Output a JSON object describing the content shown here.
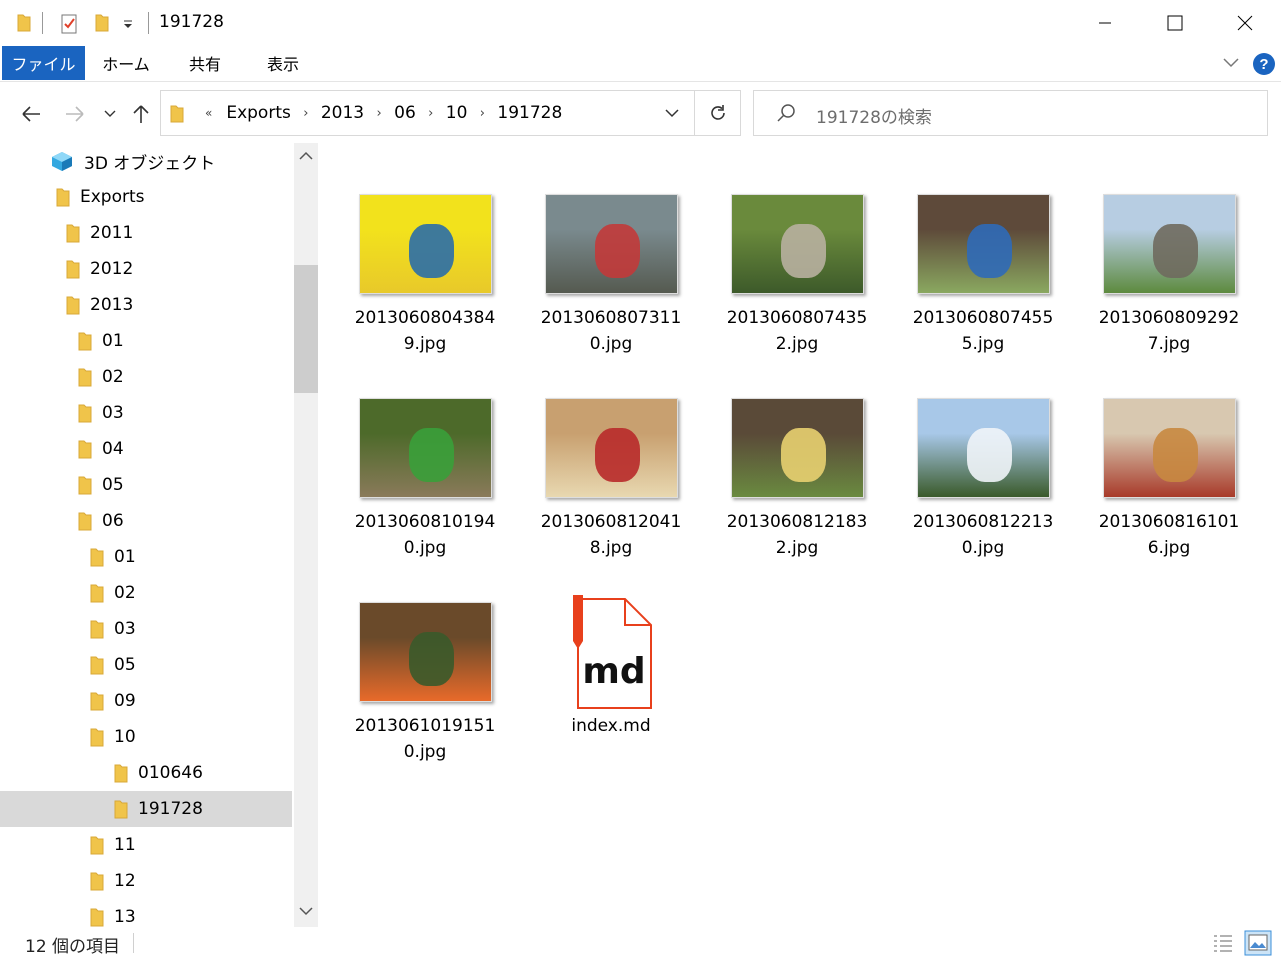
{
  "window": {
    "title": "191728"
  },
  "ribbon": {
    "tabs": [
      "ファイル",
      "ホーム",
      "共有",
      "表示"
    ]
  },
  "address": {
    "crumbs": [
      "Exports",
      "2013",
      "06",
      "10",
      "191728"
    ],
    "overflow": "«"
  },
  "search": {
    "placeholder": "191728の検索"
  },
  "tree": [
    {
      "label": "3D オブジェクト",
      "level": 0,
      "icon": "3d-objects-icon"
    },
    {
      "label": "Exports",
      "level": 0,
      "icon": "folder-icon"
    },
    {
      "label": "2011",
      "level": 1,
      "icon": "folder-icon"
    },
    {
      "label": "2012",
      "level": 1,
      "icon": "folder-icon"
    },
    {
      "label": "2013",
      "level": 1,
      "icon": "folder-icon"
    },
    {
      "label": "01",
      "level": 2,
      "icon": "folder-icon"
    },
    {
      "label": "02",
      "level": 2,
      "icon": "folder-icon"
    },
    {
      "label": "03",
      "level": 2,
      "icon": "folder-icon"
    },
    {
      "label": "04",
      "level": 2,
      "icon": "folder-icon"
    },
    {
      "label": "05",
      "level": 2,
      "icon": "folder-icon"
    },
    {
      "label": "06",
      "level": 2,
      "icon": "folder-icon"
    },
    {
      "label": "01",
      "level": 3,
      "icon": "folder-icon"
    },
    {
      "label": "02",
      "level": 3,
      "icon": "folder-icon"
    },
    {
      "label": "03",
      "level": 3,
      "icon": "folder-icon"
    },
    {
      "label": "05",
      "level": 3,
      "icon": "folder-icon"
    },
    {
      "label": "09",
      "level": 3,
      "icon": "folder-icon"
    },
    {
      "label": "10",
      "level": 3,
      "icon": "folder-icon"
    },
    {
      "label": "010646",
      "level": 4,
      "icon": "folder-icon"
    },
    {
      "label": "191728",
      "level": 4,
      "icon": "folder-icon",
      "selected": true
    },
    {
      "label": "11",
      "level": 3,
      "icon": "folder-icon"
    },
    {
      "label": "12",
      "level": 3,
      "icon": "folder-icon"
    },
    {
      "label": "13",
      "level": 3,
      "icon": "folder-icon"
    }
  ],
  "files": [
    {
      "name": "20130608043849.jpg",
      "line1": "2013060804384",
      "line2": "9.jpg",
      "type": "photo",
      "palette": [
        "#f2e21c",
        "#2a6ea8",
        "#e8c92a"
      ]
    },
    {
      "name": "20130608073110.jpg",
      "line1": "2013060807311",
      "line2": "0.jpg",
      "type": "photo",
      "palette": [
        "#7a8a8e",
        "#c23a3a",
        "#555a50"
      ]
    },
    {
      "name": "20130608074352.jpg",
      "line1": "2013060807435",
      "line2": "2.jpg",
      "type": "photo",
      "palette": [
        "#6a8a3c",
        "#b8b0a0",
        "#3d5a2a"
      ]
    },
    {
      "name": "20130608074555.jpg",
      "line1": "2013060807455",
      "line2": "5.jpg",
      "type": "photo",
      "palette": [
        "#5e4a3a",
        "#2f6ab8",
        "#8aa860"
      ]
    },
    {
      "name": "20130608092927.jpg",
      "line1": "2013060809292",
      "line2": "7.jpg",
      "type": "photo",
      "palette": [
        "#b7cde2",
        "#6f6a5e",
        "#5d8a3e"
      ]
    },
    {
      "name": "20130608101940.jpg",
      "line1": "2013060810194",
      "line2": "0.jpg",
      "type": "photo",
      "palette": [
        "#4d6a2a",
        "#3aa03a",
        "#8a7a5a"
      ]
    },
    {
      "name": "20130608120418.jpg",
      "line1": "2013060812041",
      "line2": "8.jpg",
      "type": "photo",
      "palette": [
        "#c8a070",
        "#b82a2a",
        "#e8d8b0"
      ]
    },
    {
      "name": "20130608121832.jpg",
      "line1": "2013060812183",
      "line2": "2.jpg",
      "type": "photo",
      "palette": [
        "#5a4a38",
        "#e8d070",
        "#6a8a40"
      ]
    },
    {
      "name": "20130608122130.jpg",
      "line1": "2013060812213",
      "line2": "0.jpg",
      "type": "photo",
      "palette": [
        "#a8c8e8",
        "#f0f4f8",
        "#3a5a2a"
      ]
    },
    {
      "name": "20130608161016.jpg",
      "line1": "2013060816101",
      "line2": "6.jpg",
      "type": "photo",
      "palette": [
        "#d8c8b0",
        "#c88840",
        "#a83a2a"
      ]
    },
    {
      "name": "20130610191510.jpg",
      "line1": "2013061019151",
      "line2": "0.jpg",
      "type": "photo",
      "palette": [
        "#6a4a2a",
        "#3a5a2a",
        "#e86a2a"
      ]
    },
    {
      "name": "index.md",
      "line1": "index.md",
      "line2": "",
      "type": "md",
      "icon_text": "md"
    }
  ],
  "status": {
    "count_text": "12 個の項目"
  },
  "colors": {
    "accent": "#1a64c0",
    "folder": "#f0c44a",
    "md_red": "#e8401c"
  }
}
